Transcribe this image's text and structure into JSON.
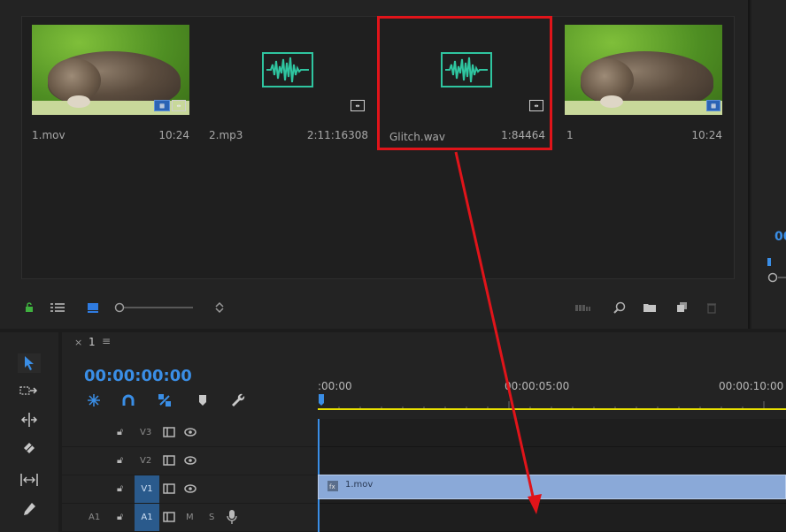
{
  "project": {
    "clips": [
      {
        "name": "1.mov",
        "duration": "10:24",
        "kind": "video"
      },
      {
        "name": "2.mp3",
        "duration": "2:11:16308",
        "kind": "audio"
      },
      {
        "name": "Glitch.wav",
        "duration": "1:84464",
        "kind": "audio"
      },
      {
        "name": "1",
        "duration": "10:24",
        "kind": "sequence"
      }
    ]
  },
  "right_panel": {
    "timecode_fragment": "00"
  },
  "timeline": {
    "sequence_tab": "1",
    "timecode": "00:00:00:00",
    "ruler_labels": [
      ":00:00",
      "00:00:05:00",
      "00:00:10:00"
    ],
    "tracks": [
      {
        "name": "V3"
      },
      {
        "name": "V2"
      },
      {
        "name": "V1"
      },
      {
        "name": "A1",
        "source": "A1",
        "mute": "M",
        "solo": "S"
      }
    ],
    "clip_v1_name": "1.mov"
  },
  "colors": {
    "highlight": "#e0141a",
    "audio_wave": "#2fc5a0",
    "timecode_blue": "#3a8ee6",
    "clip_blue": "#8aa9d8",
    "work_area_yellow": "#e8e000",
    "track_target_blue": "#2a5a8c"
  },
  "icons": {
    "tools": [
      "selection-tool-icon",
      "track-select-tool-icon",
      "ripple-edit-tool-icon",
      "razor-tool-icon",
      "slip-tool-icon",
      "pen-tool-icon"
    ],
    "project_toolbar": [
      "lock-icon",
      "list-view-icon",
      "icon-view-icon",
      "zoom-slider-icon",
      "sort-icon",
      "automate-icon",
      "find-icon",
      "new-bin-icon",
      "new-item-icon",
      "delete-icon"
    ]
  }
}
